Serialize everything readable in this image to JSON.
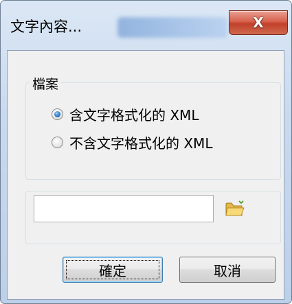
{
  "dialog": {
    "title": "文字內容...",
    "close_label": "X"
  },
  "group": {
    "title": "檔案",
    "options": [
      {
        "label": "含文字格式化的 XML",
        "selected": true
      },
      {
        "label": "不含文字格式化的 XML",
        "selected": false
      }
    ]
  },
  "file": {
    "path_value": "",
    "browse_icon": "folder-open-icon"
  },
  "buttons": {
    "ok_label": "確定",
    "cancel_label": "取消"
  },
  "colors": {
    "accent": "#3c7fb1",
    "close": "#c2402b"
  }
}
